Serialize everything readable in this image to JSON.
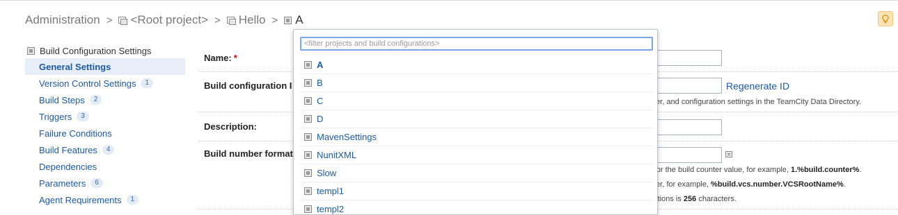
{
  "breadcrumb": {
    "root": "Administration",
    "project1": "<Root project>",
    "project2": "Hello",
    "current": "A",
    "separator": ">"
  },
  "tip_icon": "lightbulb-icon",
  "sidebar": {
    "title": "Build Configuration Settings",
    "items": [
      {
        "label": "General Settings",
        "count": null
      },
      {
        "label": "Version Control Settings",
        "count": "1"
      },
      {
        "label": "Build Steps",
        "count": "2"
      },
      {
        "label": "Triggers",
        "count": "3"
      },
      {
        "label": "Failure Conditions",
        "count": null
      },
      {
        "label": "Build Features",
        "count": "4"
      },
      {
        "label": "Dependencies",
        "count": null
      },
      {
        "label": "Parameters",
        "count": "6"
      },
      {
        "label": "Agent Requirements",
        "count": "1"
      }
    ]
  },
  "form": {
    "name_label": "Name:",
    "required_mark": "*",
    "id_label": "Build configuration I",
    "regenerate_link": "Regenerate ID",
    "id_note": "rver, and configuration settings in the TeamCity Data Directory.",
    "description_label": "Description:",
    "build_number_label": "Build number format",
    "bn_note1_pre": "r for the build counter value, for example, ",
    "bn_note1_bold": "1.%build.counter%",
    "bn_note1_post": ".",
    "bn_note2_pre": "eter, for example, ",
    "bn_note2_bold": "%build.vcs.number.VCSRootName%",
    "bn_note2_post": ".",
    "bn_note3_pre": "itutions is ",
    "bn_note3_bold": "256",
    "bn_note3_post": " characters."
  },
  "popup": {
    "filter_placeholder": "<filter projects and build configurations>",
    "items": [
      "A",
      "B",
      "C",
      "D",
      "MavenSettings",
      "NunitXML",
      "Slow",
      "templ1",
      "templ2"
    ]
  },
  "colors": {
    "link": "#1c5aa5",
    "active_bg": "#e8eef8",
    "focus_border": "#79a6e6",
    "required": "#d0021b"
  }
}
